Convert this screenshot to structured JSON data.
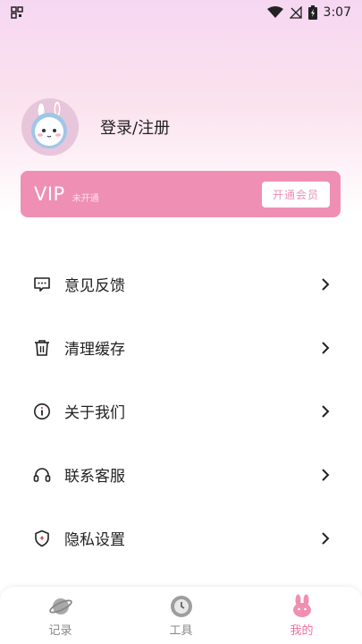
{
  "status_bar": {
    "time": "3:07"
  },
  "profile": {
    "login_label": "登录/注册"
  },
  "vip": {
    "title": "VIP",
    "status": "未开通",
    "button_label": "开通会员"
  },
  "menu": [
    {
      "label": "意见反馈",
      "icon": "feedback-icon"
    },
    {
      "label": "清理缓存",
      "icon": "trash-icon"
    },
    {
      "label": "关于我们",
      "icon": "info-icon"
    },
    {
      "label": "联系客服",
      "icon": "headset-icon"
    },
    {
      "label": "隐私设置",
      "icon": "shield-icon"
    }
  ],
  "tabs": [
    {
      "label": "记录",
      "icon": "planet-icon",
      "active": false
    },
    {
      "label": "工具",
      "icon": "clock-icon",
      "active": false
    },
    {
      "label": "我的",
      "icon": "bunny-icon",
      "active": true
    }
  ],
  "colors": {
    "accent": "#ef8fb4",
    "active_tab": "#ef6f9f"
  }
}
